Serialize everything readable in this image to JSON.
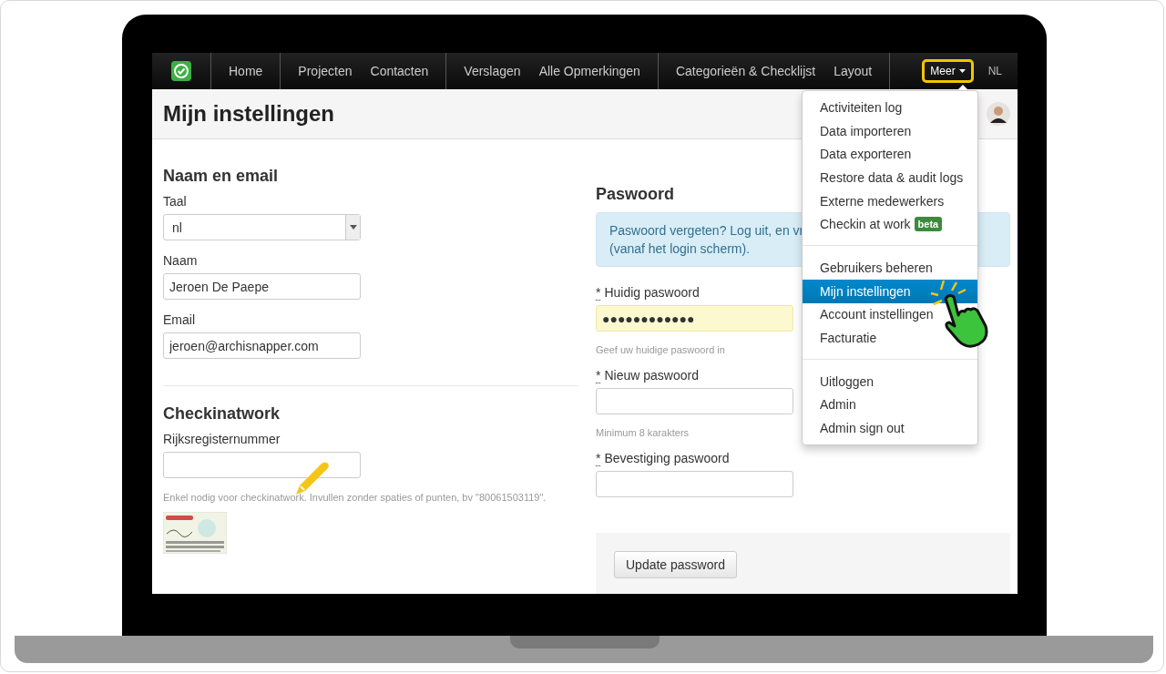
{
  "navbar": {
    "groups": [
      [
        {
          "label": "Home"
        }
      ],
      [
        {
          "label": "Projecten"
        },
        {
          "label": "Contacten"
        }
      ],
      [
        {
          "label": "Verslagen"
        },
        {
          "label": "Alle Opmerkingen"
        }
      ],
      [
        {
          "label": "Categorieën & Checklijst"
        },
        {
          "label": "Layout"
        }
      ]
    ],
    "more": {
      "label": "Meer",
      "highlighted": true,
      "expanded": true
    },
    "language": "NL"
  },
  "page_title": "Mijn instellingen",
  "left": {
    "sections": [
      {
        "heading": "Naam en email",
        "fields": [
          {
            "kind": "select",
            "label": "Taal",
            "value": "nl"
          },
          {
            "kind": "text",
            "label": "Naam",
            "value": "Jeroen De Paepe"
          },
          {
            "kind": "text",
            "label": "Email",
            "value": "jeroen@archisnapper.com"
          }
        ]
      },
      {
        "heading": "Checkinatwork",
        "fields": [
          {
            "kind": "text",
            "label": "Rijksregisternummer",
            "help": "Enkel nodig voor checkinatwork. Invullen zonder spaties of punten, bv \"80061503119\"."
          }
        ]
      }
    ]
  },
  "right": {
    "heading": "Paswoord",
    "alert": [
      "Paswoord vergeten? Log uit, en vr",
      "(vanaf het login scherm)."
    ],
    "fields": [
      {
        "marker": "*",
        "label": "Huidig paswoord",
        "value": "●●●●●●●●●●●●",
        "autofilled": true,
        "help": "Geef uw huidige paswoord in"
      },
      {
        "marker": "*",
        "label": "Nieuw paswoord",
        "help": "Minimum 8 karakters"
      },
      {
        "marker": "*",
        "label": "Bevestiging paswoord"
      }
    ],
    "button": "Update password"
  },
  "menu": {
    "sections": [
      [
        {
          "label": "Activiteiten log",
          "selected": false
        },
        {
          "label": "Data importeren",
          "selected": false
        },
        {
          "label": "Data exporteren",
          "selected": false
        },
        {
          "label": "Restore data & audit logs",
          "selected": false
        },
        {
          "label": "Externe medewerkers",
          "selected": false
        },
        {
          "label": "Checkin at work",
          "badge": "beta",
          "selected": false
        }
      ],
      [
        {
          "label": "Gebruikers beheren",
          "selected": false
        },
        {
          "label": "Mijn instellingen",
          "selected": true
        },
        {
          "label": "Account instellingen",
          "selected": false
        },
        {
          "label": "Facturatie",
          "selected": false
        }
      ],
      [
        {
          "label": "Uitloggen",
          "selected": false
        },
        {
          "label": "Admin",
          "selected": false
        },
        {
          "label": "Admin sign out",
          "selected": false
        }
      ]
    ]
  }
}
